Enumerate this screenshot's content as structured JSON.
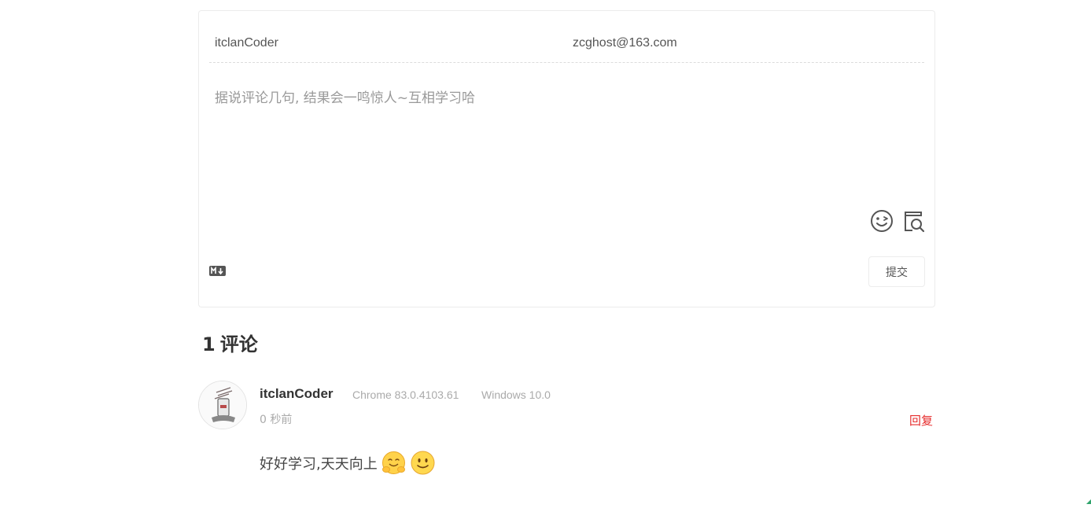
{
  "form": {
    "nick_value": "itclanCoder",
    "mail_value": "zcghost@163.com",
    "textarea_placeholder": "据说评论几句, 结果会一鸣惊人~互相学习哈",
    "emoji_icon": "emoji-smile-icon",
    "preview_icon": "preview-search-icon",
    "markdown_icon": "markdown-icon",
    "submit_label": "提交"
  },
  "comments_header": {
    "count": "1",
    "label": "评论"
  },
  "comments": [
    {
      "nick": "itclanCoder",
      "browser": "Chrome 83.0.4103.61",
      "os": "Windows 10.0",
      "time": "0 秒前",
      "reply_label": "回复",
      "text": "好好学习,天天向上",
      "emojis": [
        "hug-emoji-icon",
        "smile-emoji-icon"
      ]
    }
  ],
  "colors": {
    "reply": "#e62d2d",
    "border": "#ececec",
    "heading": "#333333",
    "muted": "#aaaaaa"
  }
}
